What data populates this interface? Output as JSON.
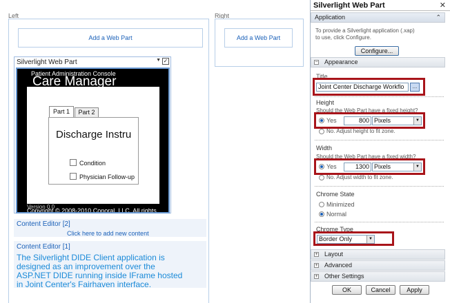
{
  "zones": {
    "left_label": "Left",
    "right_label": "Right",
    "add_web_part_left": "Add a Web Part",
    "add_web_part_right": "Add a Web Part"
  },
  "silverlight_part": {
    "title": "Silverlight Web Part",
    "menu_glyph": "▼",
    "check_glyph": "✓",
    "app_header": "Patient Administration Console",
    "app_title": "Care Manager",
    "tabs": [
      "Part 1",
      "Part 2"
    ],
    "doc_heading": "Discharge Instru",
    "options": [
      "Condition",
      "Physician Follow-up"
    ],
    "version": "Version 0.0",
    "copyright": "Copyright © 2008-2010 Conoral, LLC. All rights"
  },
  "content_editor_2": {
    "title": "Content Editor [2]",
    "link": "Click here to add new content"
  },
  "content_editor_1": {
    "title": "Content Editor [1]",
    "body": [
      "The Silverlight DIDE Client application is",
      "designed as an improvement over the",
      "ASP.NET DIDE running inside IFrame hosted",
      "in Joint Center's Fairhaven interface."
    ]
  },
  "tool_pane": {
    "title": "Silverlight Web Part",
    "close_glyph": "✕",
    "application_section": "Application",
    "application_hint": [
      "To provide a Silverlight application (.xap)",
      "to use, click Configure."
    ],
    "configure_button": "Configure...",
    "appearance_section": "Appearance",
    "title_label": "Title",
    "title_value": "Joint Center Discharge Workflo",
    "browse_glyph": "...",
    "height_label": "Height",
    "height_question": "Should the Web Part have a fixed height?",
    "height_yes": "Yes",
    "height_value": "800",
    "height_unit": "Pixels",
    "height_no": "No. Adjust height to fit zone.",
    "width_label": "Width",
    "width_question": "Should the Web Part have a fixed width?",
    "width_yes": "Yes",
    "width_value": "1300",
    "width_unit": "Pixels",
    "width_no": "No. Adjust width to fit zone.",
    "chrome_state_label": "Chrome State",
    "chrome_minimized": "Minimized",
    "chrome_normal": "Normal",
    "chrome_type_label": "Chrome Type",
    "chrome_type_value": "Border Only",
    "layout_section": "Layout",
    "advanced_section": "Advanced",
    "other_section": "Other Settings",
    "ok": "OK",
    "cancel": "Cancel",
    "apply": "Apply"
  },
  "colors": {
    "highlight": "#a8141a",
    "link": "#1a60b8",
    "body_text": "#1a8ad8"
  }
}
